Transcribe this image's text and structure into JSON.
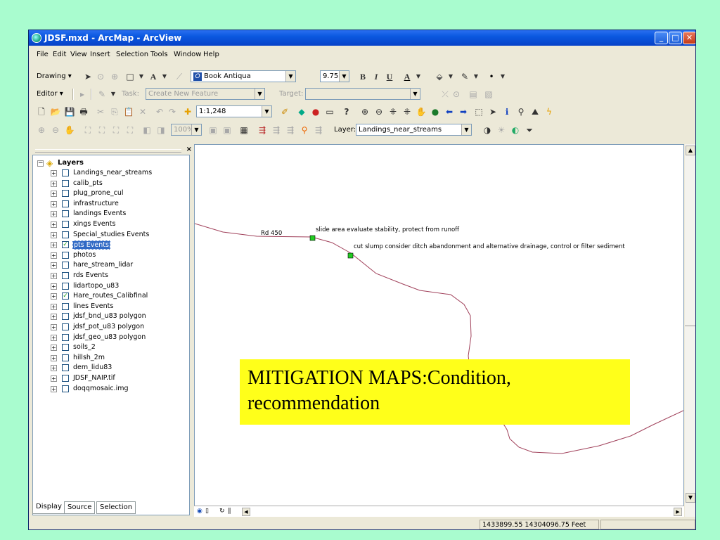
{
  "window": {
    "title": "JDSF.mxd - ArcMap - ArcView"
  },
  "window_buttons": {
    "minimize": "_",
    "maximize": "□",
    "close": "✕"
  },
  "menu": [
    "File",
    "Edit",
    "View",
    "Insert",
    "Selection",
    "Tools",
    "Window",
    "Help"
  ],
  "draw_toolbar": {
    "drawing_label": "Drawing ▾",
    "text_button": "A",
    "font_name": "Book Antiqua",
    "font_size": "9.75",
    "bold": "B",
    "italic": "I",
    "underline": "U",
    "font_color_button": "A"
  },
  "editor_toolbar": {
    "editor_label": "Editor ▾",
    "task_label": "Task:",
    "task_value": "Create New Feature",
    "target_label": "Target:",
    "target_value": ""
  },
  "standard_toolbar": {
    "scale": "1:1,248"
  },
  "layout_toolbar": {
    "zoom": "100%",
    "layer_label": "Layer:",
    "layer_value": "Landings_near_streams"
  },
  "toc": {
    "root": "Layers",
    "layers": [
      {
        "name": "Landings_near_streams",
        "checked": false,
        "selected": false
      },
      {
        "name": "calib_pts",
        "checked": false,
        "selected": false
      },
      {
        "name": "plug_prone_cul",
        "checked": false,
        "selected": false
      },
      {
        "name": "infrastructure",
        "checked": false,
        "selected": false
      },
      {
        "name": "landings Events",
        "checked": false,
        "selected": false
      },
      {
        "name": "xings Events",
        "checked": false,
        "selected": false
      },
      {
        "name": "Special_studies Events",
        "checked": false,
        "selected": false
      },
      {
        "name": "pts Events",
        "checked": true,
        "selected": true
      },
      {
        "name": "photos",
        "checked": false,
        "selected": false
      },
      {
        "name": "hare_stream_lidar",
        "checked": false,
        "selected": false
      },
      {
        "name": "rds Events",
        "checked": false,
        "selected": false
      },
      {
        "name": "lidartopo_u83",
        "checked": false,
        "selected": false
      },
      {
        "name": "Hare_routes_Calibfinal",
        "checked": true,
        "selected": false
      },
      {
        "name": "lines Events",
        "checked": false,
        "selected": false
      },
      {
        "name": "jdsf_bnd_u83 polygon",
        "checked": false,
        "selected": false
      },
      {
        "name": "jdsf_pot_u83 polygon",
        "checked": false,
        "selected": false
      },
      {
        "name": "jdsf_geo_u83 polygon",
        "checked": false,
        "selected": false
      },
      {
        "name": "soils_2",
        "checked": false,
        "selected": false
      },
      {
        "name": "hillsh_2m",
        "checked": false,
        "selected": false
      },
      {
        "name": "dem_lidu83",
        "checked": false,
        "selected": false
      },
      {
        "name": "JDSF_NAIP.tif",
        "checked": false,
        "selected": false
      },
      {
        "name": "doqqmosaic.img",
        "checked": false,
        "selected": false
      }
    ],
    "tabs": [
      "Display",
      "Source",
      "Selection"
    ]
  },
  "map": {
    "road_label": "Rd 450",
    "point1_label": "slide area evaluate stability, protect from runoff",
    "point2_label": "cut slump consider ditch abandonment and alternative drainage, control or filter sediment",
    "road_color": "#a0405a",
    "point_color": "#22cc22"
  },
  "status": {
    "coordinates": "1433899.55  14304096.75 Feet"
  },
  "caption": {
    "line1": "MITIGATION MAPS:Condition,",
    "line2": "recommendation"
  }
}
